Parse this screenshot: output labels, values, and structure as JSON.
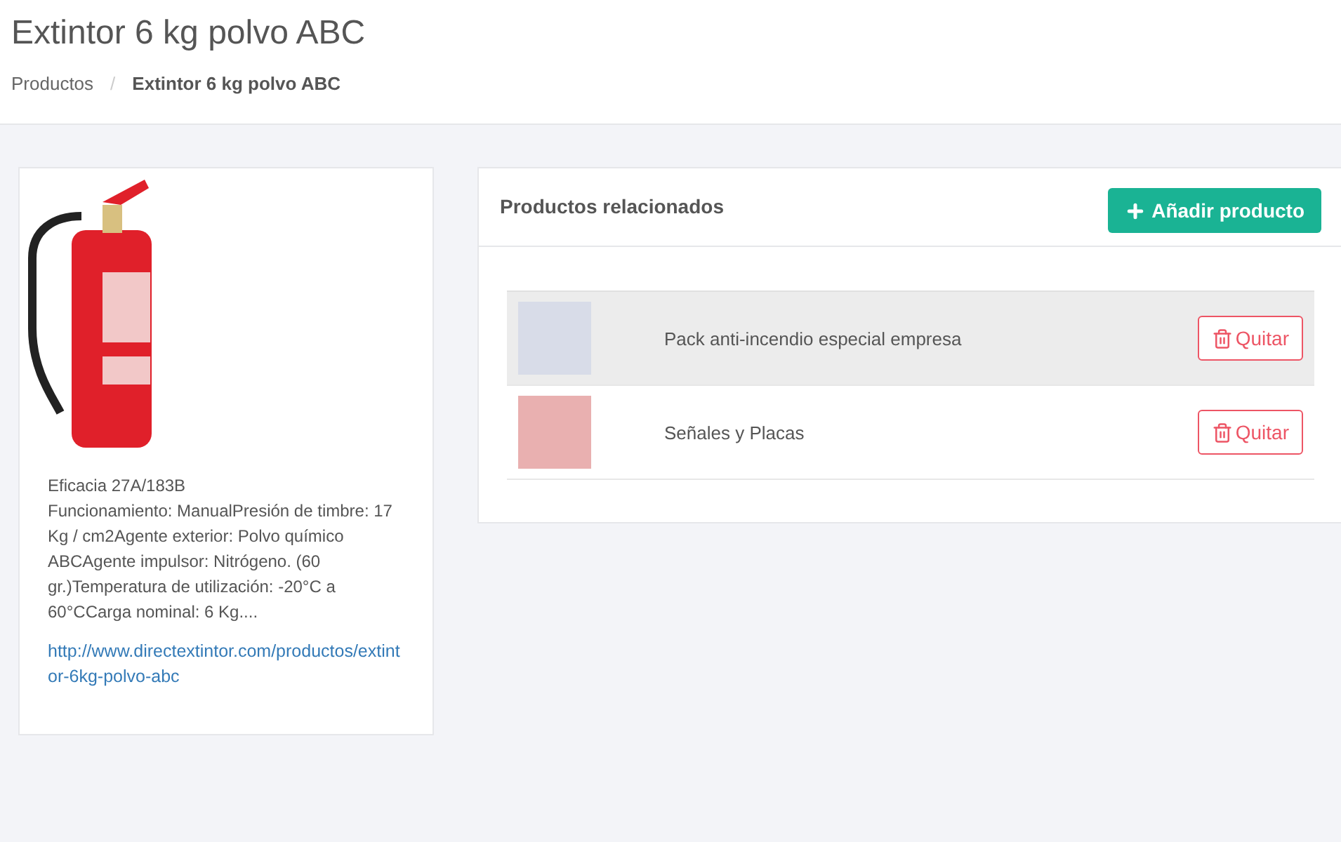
{
  "page": {
    "title": "Extintor 6 kg polvo ABC"
  },
  "breadcrumb_separator": "/",
  "breadcrumb": [
    {
      "label": "Productos",
      "current": false
    },
    {
      "label": "Extintor 6 kg polvo ABC",
      "current": true
    }
  ],
  "product": {
    "efficacy": "Eficacia 27A/183B",
    "description": "Funcionamiento: ManualPresión de timbre: 17 Kg / cm2Agente exterior: Polvo químico ABCAgente impulsor: Nitrógeno. (60 gr.)Temperatura de utilización: -20°C a 60°CCarga nominal: 6 Kg....",
    "link": "http://www.directextintor.com/productos/extintor-6kg-polvo-abc"
  },
  "related": {
    "title": "Productos relacionados",
    "add_button": "Añadir producto",
    "rows": [
      {
        "name": "Pack anti-incendio especial empresa",
        "highlighted": true,
        "remove_button": "Quitar"
      },
      {
        "name": "Señales y Placas",
        "highlighted": false,
        "remove_button": "Quitar"
      }
    ]
  }
}
